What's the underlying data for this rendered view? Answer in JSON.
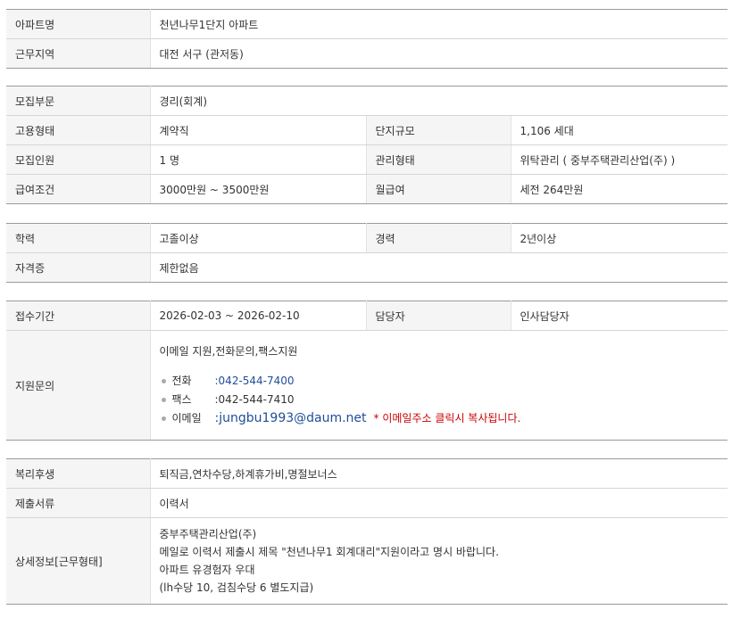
{
  "section1": {
    "apt_name_label": "아파트명",
    "apt_name": "천년나무1단지 아파트",
    "region_label": "근무지역",
    "region": "대전  서구 (관저동)"
  },
  "section2": {
    "dept_label": "모집부문",
    "dept": "경리(회계)",
    "employment_label": "고용형태",
    "employment": "계약직",
    "scale_label": "단지규모",
    "scale": "1,106 세대",
    "recruit_label": "모집인원",
    "recruit": "1 명",
    "manage_label": "관리형태",
    "manage": "위탁관리 ( 중부주택관리산업(주) )",
    "salary_label": "급여조건",
    "salary": "3000만원 ~ 3500만원",
    "monthly_label": "월급여",
    "monthly": "세전 264만원"
  },
  "section3": {
    "edu_label": "학력",
    "edu": "고졸이상",
    "career_label": "경력",
    "career": "2년이상",
    "cert_label": "자격증",
    "cert": "제한없음"
  },
  "section4": {
    "period_label": "접수기간",
    "period": "2026-02-03 ~ 2026-02-10",
    "manager_label": "담당자",
    "manager": "인사담당자",
    "inquiry_label": "지원문의",
    "inquiry_intro": "이메일 지원,전화문의,팩스지원",
    "contacts": [
      {
        "label": "전화",
        "value": ":042-544-7400"
      },
      {
        "label": "팩스",
        "value": ":042-544-7410"
      },
      {
        "label": "이메일",
        "value": ":jungbu1993@daum.net"
      }
    ],
    "email_note": "* 이메일주소 클릭시 복사됩니다."
  },
  "section5": {
    "welfare_label": "복리후생",
    "welfare": "퇴직금,연차수당,하계휴가비,명절보너스",
    "docs_label": "제출서류",
    "docs": "이력서",
    "detail_label": "상세정보[근무형태]",
    "detail_lines": [
      "중부주택관리산업(주)",
      "메일로 이력서 제출시 제목 \"천년나무1 회계대리\"지원이라고 명시 바랍니다.",
      "아파트 유경험자 우대",
      "(lh수당 10, 검침수당 6 별도지급)"
    ]
  },
  "colors": {
    "header_bg": "#f5f5f5",
    "link_blue": "#1f4e99",
    "note_red": "#cc0000"
  }
}
